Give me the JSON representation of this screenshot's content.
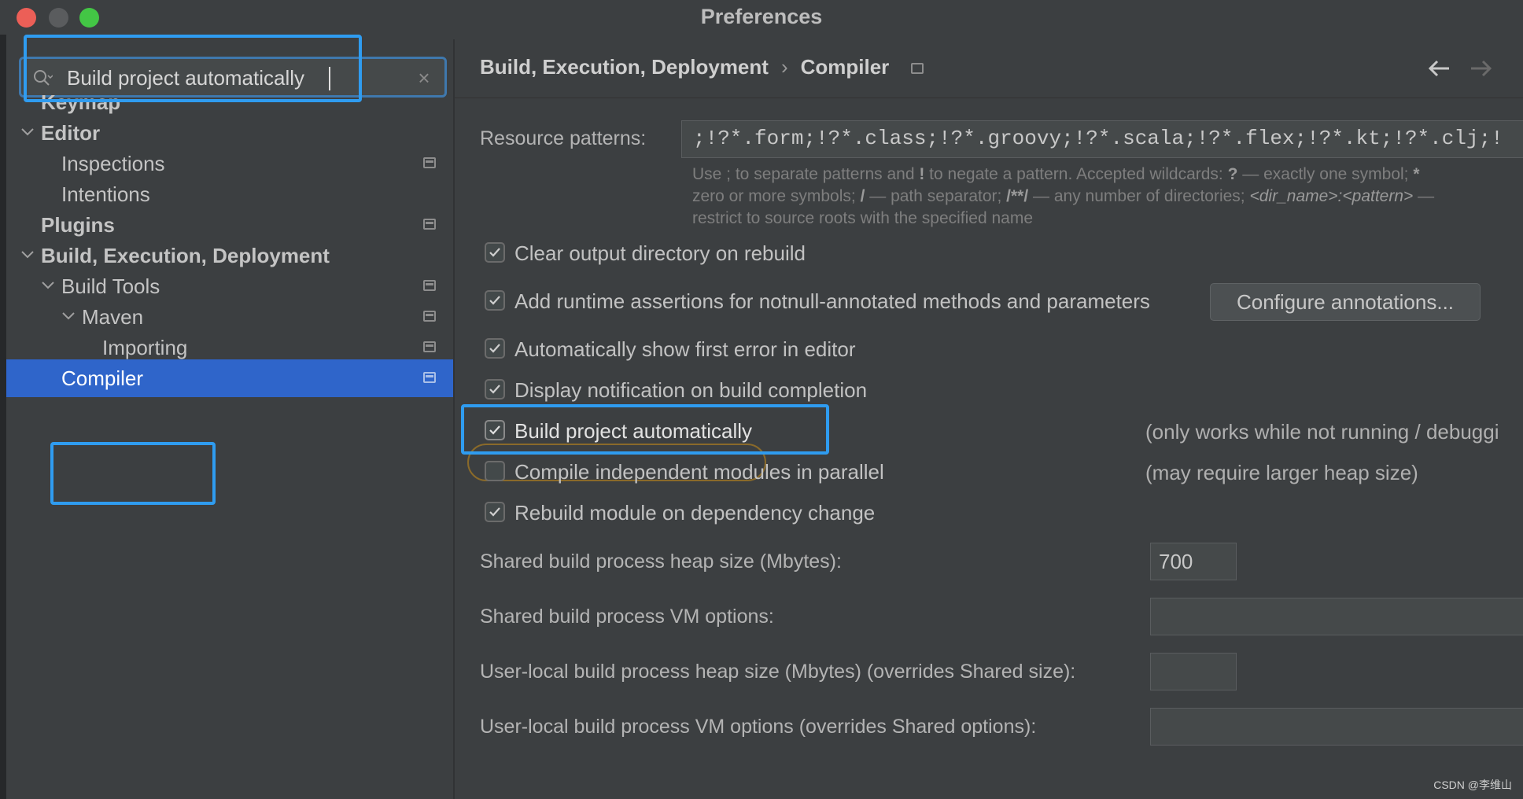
{
  "window": {
    "title": "Preferences"
  },
  "search": {
    "value": "Build project automatically",
    "clear_icon": "×"
  },
  "sidebar": {
    "items": [
      {
        "label": "Keymap"
      },
      {
        "label": "Editor"
      },
      {
        "label": "Inspections"
      },
      {
        "label": "Intentions"
      },
      {
        "label": "Plugins"
      },
      {
        "label": "Build, Execution, Deployment"
      },
      {
        "label": "Build Tools"
      },
      {
        "label": "Maven"
      },
      {
        "label": "Importing"
      },
      {
        "label": "Compiler"
      }
    ]
  },
  "header": {
    "breadcrumb_parent": "Build, Execution, Deployment",
    "breadcrumb_sep": "›",
    "breadcrumb_current": "Compiler"
  },
  "compiler": {
    "resource_patterns_label": "Resource patterns:",
    "resource_patterns_value": ";!?*.form;!?*.class;!?*.groovy;!?*.scala;!?*.flex;!?*.kt;!?*.clj;!",
    "hint_line1_a": "Use ; to separate patterns and ",
    "hint_line1_b": "!",
    "hint_line1_c": " to negate a pattern. Accepted wildcards: ",
    "hint_line1_d": "?",
    "hint_line1_e": " — exactly one symbol; ",
    "hint_line1_f": "*",
    "hint_line2_a": "zero or more symbols; ",
    "hint_line2_b": "/",
    "hint_line2_c": " — path separator; ",
    "hint_line2_d": "/**/",
    "hint_line2_e": " — any number of directories; ",
    "hint_line2_f": "<dir_name>:<pattern>",
    "hint_line2_g": " —",
    "hint_line3": "restrict to source roots with the specified name",
    "options": [
      {
        "label": "Clear output directory on rebuild",
        "checked": true
      },
      {
        "label": "Add runtime assertions for notnull-annotated methods and parameters",
        "checked": true
      },
      {
        "label": "Automatically show first error in editor",
        "checked": true
      },
      {
        "label": "Display notification on build completion",
        "checked": true
      },
      {
        "label": "Build project automatically",
        "checked": true
      },
      {
        "label": "Compile independent modules in parallel",
        "checked": false
      },
      {
        "label": "Rebuild module on dependency change",
        "checked": true
      }
    ],
    "configure_annotations_button": "Configure annotations...",
    "build_auto_note": "(only works while not running / debuggi",
    "parallel_note": "(may require larger heap size)",
    "shared_heap_label": "Shared build process heap size (Mbytes):",
    "shared_heap_value": "700",
    "shared_vm_label": "Shared build process VM options:",
    "user_heap_label": "User-local build process heap size (Mbytes) (overrides Shared size):",
    "user_vm_label": "User-local build process VM options (overrides Shared options):"
  },
  "watermark": "CSDN @李维山",
  "colors": {
    "selection": "#2f65ca",
    "annotation_highlight": "#2f9cf0",
    "background": "#3c3f41"
  }
}
